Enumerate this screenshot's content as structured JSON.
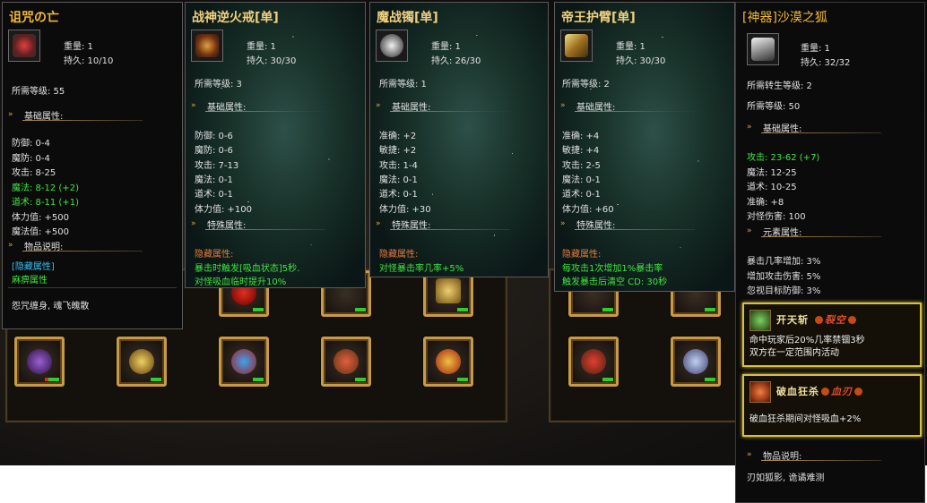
{
  "tooltips": [
    {
      "title": "诅咒の亡",
      "weight": "重量: 1",
      "durability": "持久: 10/10",
      "req": "所需等级: 55",
      "basic_header": "基础属性:",
      "basic": [
        {
          "text": "防御: 0-4",
          "c": "white"
        },
        {
          "text": "魔防: 0-4",
          "c": "white"
        },
        {
          "text": "攻击: 8-25",
          "c": "white"
        },
        {
          "text": "魔法: 8-12 (+2)",
          "c": "green"
        },
        {
          "text": "道术: 8-11 (+1)",
          "c": "green"
        },
        {
          "text": "体力值: +500",
          "c": "white"
        },
        {
          "text": "魔法值: +500",
          "c": "white"
        }
      ],
      "desc_header": "物品说明:",
      "desc": [
        {
          "text": "[隐藏属性]",
          "c": "cyan"
        },
        {
          "text": "麻痹属性",
          "c": "green"
        }
      ],
      "flavor": "怨咒缠身, 魂飞魄散"
    },
    {
      "title": "战神逆火戒[单]",
      "weight": "重量: 1",
      "durability": "持久: 30/30",
      "req": "所需等级: 3",
      "basic_header": "基础属性:",
      "basic": [
        {
          "text": "防御: 0-6",
          "c": "white"
        },
        {
          "text": "魔防: 0-6",
          "c": "white"
        },
        {
          "text": "攻击: 7-13",
          "c": "white"
        },
        {
          "text": "魔法: 0-1",
          "c": "white"
        },
        {
          "text": "道术: 0-1",
          "c": "white"
        },
        {
          "text": "体力值: +100",
          "c": "white"
        }
      ],
      "special_header": "特殊属性:",
      "hidden_header": "隐藏属性:",
      "hidden": [
        {
          "text": "暴击时触发[吸血状态]5秒.",
          "c": "green"
        },
        {
          "text": "对怪吸血临时提升10%",
          "c": "green"
        }
      ]
    },
    {
      "title": "魔战镯[单]",
      "weight": "重量: 1",
      "durability": "持久: 26/30",
      "req": "所需等级: 1",
      "basic_header": "基础属性:",
      "basic": [
        {
          "text": "准确: +2",
          "c": "white"
        },
        {
          "text": "敏捷: +2",
          "c": "white"
        },
        {
          "text": "攻击: 1-4",
          "c": "white"
        },
        {
          "text": "魔法: 0-1",
          "c": "white"
        },
        {
          "text": "道术: 0-1",
          "c": "white"
        },
        {
          "text": "体力值: +30",
          "c": "white"
        }
      ],
      "special_header": "特殊属性:",
      "hidden_header": "隐藏属性:",
      "hidden": [
        {
          "text": "对怪暴击率几率+5%",
          "c": "green"
        }
      ]
    },
    {
      "title": "帝王护臂[单]",
      "weight": "重量: 1",
      "durability": "持久: 30/30",
      "req": "所需等级: 2",
      "basic_header": "基础属性:",
      "basic": [
        {
          "text": "准确: +4",
          "c": "white"
        },
        {
          "text": "敏捷: +4",
          "c": "white"
        },
        {
          "text": "攻击: 2-5",
          "c": "white"
        },
        {
          "text": "魔法: 0-1",
          "c": "white"
        },
        {
          "text": "道术: 0-1",
          "c": "white"
        },
        {
          "text": "体力值: +60",
          "c": "white"
        }
      ],
      "special_header": "特殊属性:",
      "hidden_header": "隐藏属性:",
      "hidden": [
        {
          "text": "每攻击1次增加1%暴击率",
          "c": "green"
        },
        {
          "text": "触发暴击后清空 CD: 30秒",
          "c": "green"
        }
      ]
    },
    {
      "title": "[神器]沙漠之狐",
      "weight": "重量: 1",
      "durability": "持久: 32/32",
      "req_rebirth": "所需转生等级: 2",
      "req": "所需等级: 50",
      "basic_header": "基础属性:",
      "basic": [
        {
          "text": "攻击: 23-62 (+7)",
          "c": "green"
        },
        {
          "text": "魔法: 12-25",
          "c": "white"
        },
        {
          "text": "道术: 10-25",
          "c": "white"
        },
        {
          "text": "准确: +8",
          "c": "white"
        },
        {
          "text": "对怪伤害: 100",
          "c": "white"
        }
      ],
      "element_header": "元素属性:",
      "element": [
        {
          "text": "暴击几率增加: 3%",
          "c": "white"
        },
        {
          "text": "增加攻击伤害: 5%",
          "c": "white"
        },
        {
          "text": "忽视目标防御: 3%",
          "c": "white"
        }
      ],
      "skills": [
        {
          "name": "开天斩",
          "tag": "裂空",
          "desc": [
            "命中玩家后20%几率禁锢3秒",
            "双方在一定范围内活动"
          ]
        },
        {
          "name": "破血狂杀",
          "tag": "血刃",
          "desc": [
            "破血狂杀期间对怪吸血+2%"
          ]
        }
      ],
      "desc_header": "物品说明:",
      "flavor": "刃如狐影, 诡谲难测"
    }
  ],
  "colors": {
    "gold": "#f2b938",
    "title": "#f0d080",
    "green": "#3ee63e",
    "cyan": "#39c0f0",
    "orange": "#e27b3c",
    "slot_border": "#c99a44",
    "skill_border": "#d8c040"
  },
  "icons": [
    "necklace-icon",
    "ring-icon",
    "bracelet-icon",
    "armguard-icon",
    "pistol-icon",
    "gem-slot-icon"
  ]
}
